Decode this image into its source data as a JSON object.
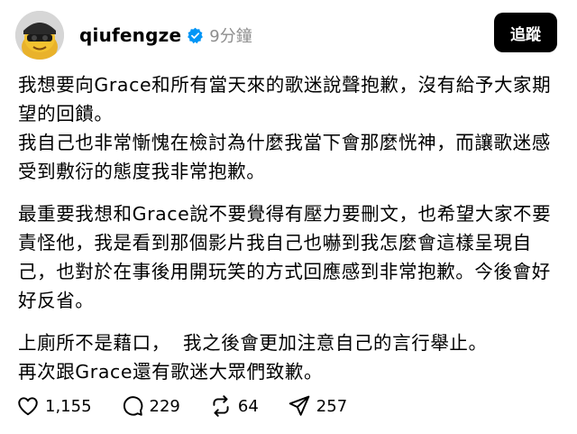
{
  "header": {
    "username": "qiufengze",
    "time": "9分鐘",
    "follow_label": "追蹤"
  },
  "post": {
    "paragraphs": [
      "我想要向Grace和所有當天來的歌迷說聲抱歉，沒有給予大家期望的回饋。",
      "我自己也非常慚愧在檢討為什麼我當下會那麼恍神，而讓歌迷感受到敷衍的態度我非常抱歉。",
      "最重要我想和Grace說不要覺得有壓力要刪文，也希望大家不要責怪他，我是看到那個影片我自己也嚇到我怎麼會這樣呈現自己，也對於在事後用開玩笑的方式回應感到非常抱歉。今後會好好反省。",
      "上廁所不是藉口，  我之後會更加注意自己的言行舉止。",
      "再次跟Grace還有歌迷大眾們致歉。"
    ]
  },
  "actions": {
    "likes": "1,155",
    "comments": "229",
    "reposts": "64",
    "shares": "257"
  },
  "icons": {
    "like": "heart-icon",
    "comment": "comment-icon",
    "repost": "repost-icon",
    "share": "share-icon",
    "verified": "verified-badge-icon"
  },
  "colors": {
    "verified_blue": "#0095f6",
    "time_gray": "#8e8e8e",
    "button_black": "#000000"
  }
}
